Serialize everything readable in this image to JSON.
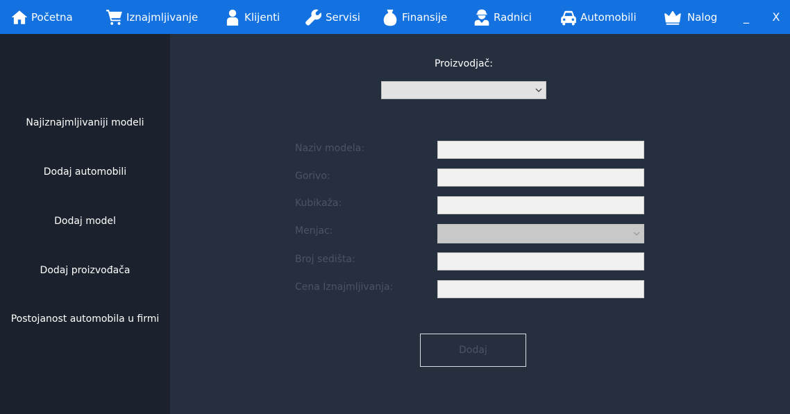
{
  "nav": {
    "home_label": "Početna",
    "rental_label": "Iznajmljivanje",
    "clients_label": "Klijenti",
    "services_label": "Servisi",
    "finance_label": "Finansije",
    "workers_label": "Radnici",
    "cars_label": "Automobili",
    "account_label": "Nalog",
    "minimize_label": "_",
    "close_label": "X"
  },
  "sidebar": {
    "items": [
      "Najiznajmljivaniji modeli",
      "Dodaj automobili",
      "Dodaj model",
      "Dodaj proizvođača",
      "Postojanost automobila u firmi"
    ]
  },
  "form": {
    "manufacturer_label": "Proizvodjač:",
    "manufacturer_value": "",
    "fields": [
      {
        "label": "Naziv modela:",
        "value": ""
      },
      {
        "label": "Gorivo:",
        "value": ""
      },
      {
        "label": "Kubikaža:",
        "value": ""
      },
      {
        "label": "Menjac:",
        "value": ""
      },
      {
        "label": "Broj sedišta:",
        "value": ""
      },
      {
        "label": "Cena Iznajmljivanja:",
        "value": ""
      }
    ],
    "add_button_label": "Dodaj"
  },
  "colors": {
    "topbar": "#1472e0",
    "sidebar": "#1c222d",
    "main": "#262f3e",
    "muted_text": "#4a5466"
  }
}
